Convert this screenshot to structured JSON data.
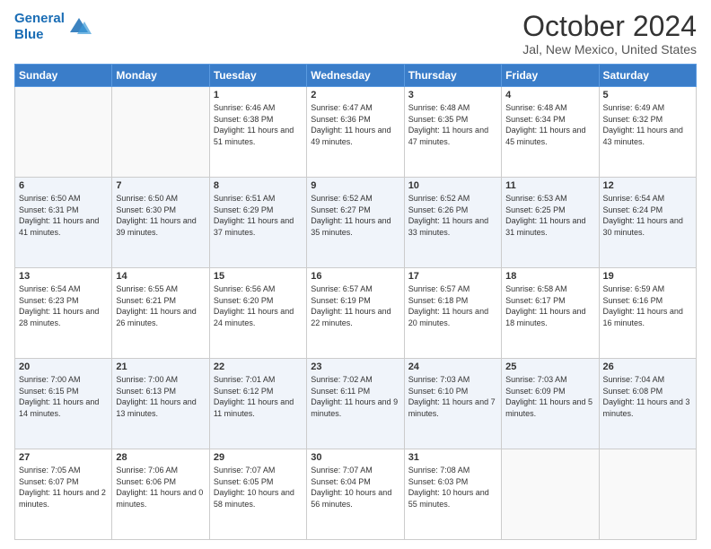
{
  "header": {
    "logo_line1": "General",
    "logo_line2": "Blue",
    "title": "October 2024",
    "location": "Jal, New Mexico, United States"
  },
  "days_of_week": [
    "Sunday",
    "Monday",
    "Tuesday",
    "Wednesday",
    "Thursday",
    "Friday",
    "Saturday"
  ],
  "weeks": [
    [
      {
        "day": "",
        "info": ""
      },
      {
        "day": "",
        "info": ""
      },
      {
        "day": "1",
        "info": "Sunrise: 6:46 AM\nSunset: 6:38 PM\nDaylight: 11 hours and 51 minutes."
      },
      {
        "day": "2",
        "info": "Sunrise: 6:47 AM\nSunset: 6:36 PM\nDaylight: 11 hours and 49 minutes."
      },
      {
        "day": "3",
        "info": "Sunrise: 6:48 AM\nSunset: 6:35 PM\nDaylight: 11 hours and 47 minutes."
      },
      {
        "day": "4",
        "info": "Sunrise: 6:48 AM\nSunset: 6:34 PM\nDaylight: 11 hours and 45 minutes."
      },
      {
        "day": "5",
        "info": "Sunrise: 6:49 AM\nSunset: 6:32 PM\nDaylight: 11 hours and 43 minutes."
      }
    ],
    [
      {
        "day": "6",
        "info": "Sunrise: 6:50 AM\nSunset: 6:31 PM\nDaylight: 11 hours and 41 minutes."
      },
      {
        "day": "7",
        "info": "Sunrise: 6:50 AM\nSunset: 6:30 PM\nDaylight: 11 hours and 39 minutes."
      },
      {
        "day": "8",
        "info": "Sunrise: 6:51 AM\nSunset: 6:29 PM\nDaylight: 11 hours and 37 minutes."
      },
      {
        "day": "9",
        "info": "Sunrise: 6:52 AM\nSunset: 6:27 PM\nDaylight: 11 hours and 35 minutes."
      },
      {
        "day": "10",
        "info": "Sunrise: 6:52 AM\nSunset: 6:26 PM\nDaylight: 11 hours and 33 minutes."
      },
      {
        "day": "11",
        "info": "Sunrise: 6:53 AM\nSunset: 6:25 PM\nDaylight: 11 hours and 31 minutes."
      },
      {
        "day": "12",
        "info": "Sunrise: 6:54 AM\nSunset: 6:24 PM\nDaylight: 11 hours and 30 minutes."
      }
    ],
    [
      {
        "day": "13",
        "info": "Sunrise: 6:54 AM\nSunset: 6:23 PM\nDaylight: 11 hours and 28 minutes."
      },
      {
        "day": "14",
        "info": "Sunrise: 6:55 AM\nSunset: 6:21 PM\nDaylight: 11 hours and 26 minutes."
      },
      {
        "day": "15",
        "info": "Sunrise: 6:56 AM\nSunset: 6:20 PM\nDaylight: 11 hours and 24 minutes."
      },
      {
        "day": "16",
        "info": "Sunrise: 6:57 AM\nSunset: 6:19 PM\nDaylight: 11 hours and 22 minutes."
      },
      {
        "day": "17",
        "info": "Sunrise: 6:57 AM\nSunset: 6:18 PM\nDaylight: 11 hours and 20 minutes."
      },
      {
        "day": "18",
        "info": "Sunrise: 6:58 AM\nSunset: 6:17 PM\nDaylight: 11 hours and 18 minutes."
      },
      {
        "day": "19",
        "info": "Sunrise: 6:59 AM\nSunset: 6:16 PM\nDaylight: 11 hours and 16 minutes."
      }
    ],
    [
      {
        "day": "20",
        "info": "Sunrise: 7:00 AM\nSunset: 6:15 PM\nDaylight: 11 hours and 14 minutes."
      },
      {
        "day": "21",
        "info": "Sunrise: 7:00 AM\nSunset: 6:13 PM\nDaylight: 11 hours and 13 minutes."
      },
      {
        "day": "22",
        "info": "Sunrise: 7:01 AM\nSunset: 6:12 PM\nDaylight: 11 hours and 11 minutes."
      },
      {
        "day": "23",
        "info": "Sunrise: 7:02 AM\nSunset: 6:11 PM\nDaylight: 11 hours and 9 minutes."
      },
      {
        "day": "24",
        "info": "Sunrise: 7:03 AM\nSunset: 6:10 PM\nDaylight: 11 hours and 7 minutes."
      },
      {
        "day": "25",
        "info": "Sunrise: 7:03 AM\nSunset: 6:09 PM\nDaylight: 11 hours and 5 minutes."
      },
      {
        "day": "26",
        "info": "Sunrise: 7:04 AM\nSunset: 6:08 PM\nDaylight: 11 hours and 3 minutes."
      }
    ],
    [
      {
        "day": "27",
        "info": "Sunrise: 7:05 AM\nSunset: 6:07 PM\nDaylight: 11 hours and 2 minutes."
      },
      {
        "day": "28",
        "info": "Sunrise: 7:06 AM\nSunset: 6:06 PM\nDaylight: 11 hours and 0 minutes."
      },
      {
        "day": "29",
        "info": "Sunrise: 7:07 AM\nSunset: 6:05 PM\nDaylight: 10 hours and 58 minutes."
      },
      {
        "day": "30",
        "info": "Sunrise: 7:07 AM\nSunset: 6:04 PM\nDaylight: 10 hours and 56 minutes."
      },
      {
        "day": "31",
        "info": "Sunrise: 7:08 AM\nSunset: 6:03 PM\nDaylight: 10 hours and 55 minutes."
      },
      {
        "day": "",
        "info": ""
      },
      {
        "day": "",
        "info": ""
      }
    ]
  ]
}
